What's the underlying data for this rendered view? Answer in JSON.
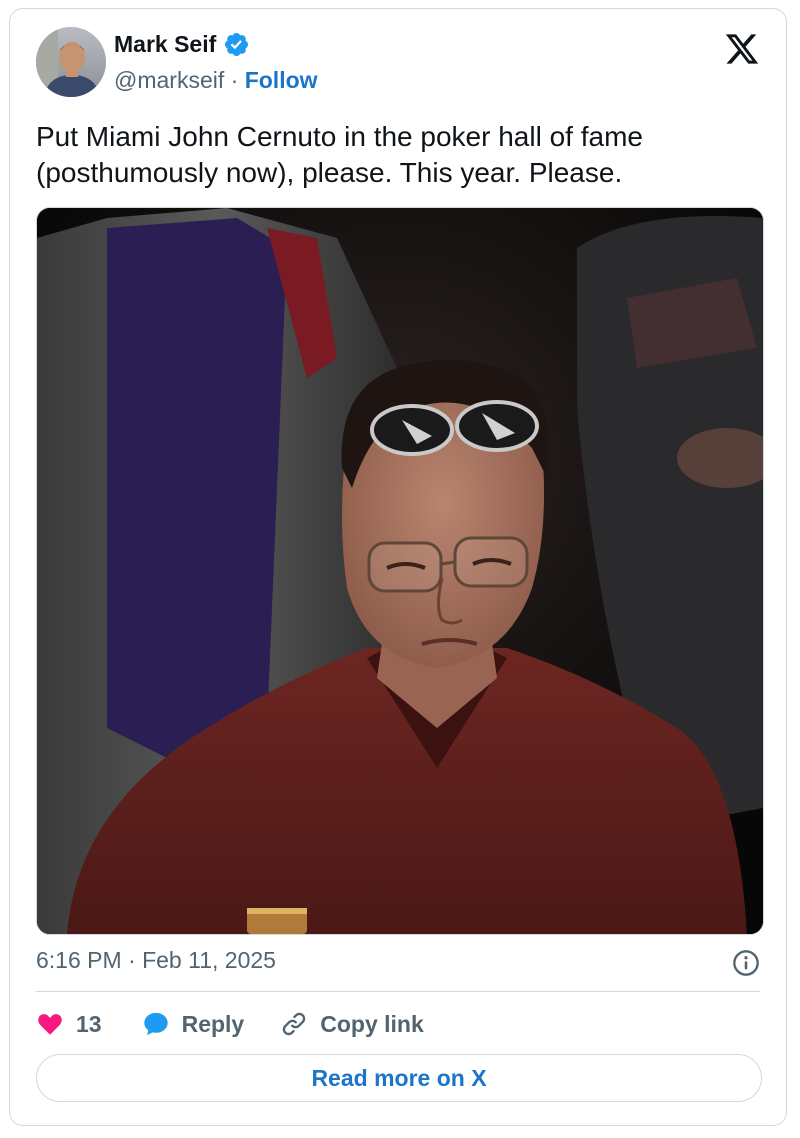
{
  "author": {
    "name": "Mark Seif",
    "handle": "@markseif",
    "separator": "·",
    "follow_label": "Follow",
    "verified": true
  },
  "tweet": {
    "text": "Put Miami John Cernuto in the poker hall of fame (posthumously now), please. This year. Please.",
    "timestamp": "6:16 PM · Feb 11, 2025"
  },
  "actions": {
    "like_count": "13",
    "reply_label": "Reply",
    "copy_link_label": "Copy link"
  },
  "read_more_label": "Read more on X",
  "colors": {
    "accent": "#1d75c9",
    "verified": "#1d9bf0",
    "like": "#f91880",
    "reply_icon": "#1d9bf0",
    "muted": "#536471",
    "border": "#cfd9de"
  },
  "icons": [
    "x-logo-icon",
    "verified-badge-icon",
    "info-icon",
    "heart-icon",
    "reply-bubble-icon",
    "link-icon"
  ]
}
